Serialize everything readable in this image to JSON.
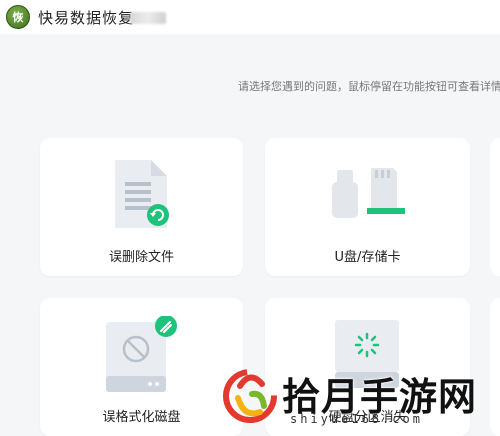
{
  "app": {
    "logo_text": "恢",
    "title": "快易数据恢复"
  },
  "hint": "请选择您遇到的问题，鼠标停留在功能按钮可查看详情",
  "cards": [
    {
      "label": "误删除文件",
      "icon": "file-restore-icon"
    },
    {
      "label": "U盘/存储卡",
      "icon": "usb-sdcard-icon"
    },
    {
      "label": "误格式化磁盘",
      "icon": "format-disk-icon"
    },
    {
      "label": "硬盘分区消失",
      "icon": "partition-disk-icon"
    }
  ],
  "watermark": {
    "text": "拾月手游网",
    "url": "shiyue168.com"
  },
  "colors": {
    "accent_green": "#1ec27a",
    "background": "#f5f6f8",
    "card": "#ffffff"
  }
}
